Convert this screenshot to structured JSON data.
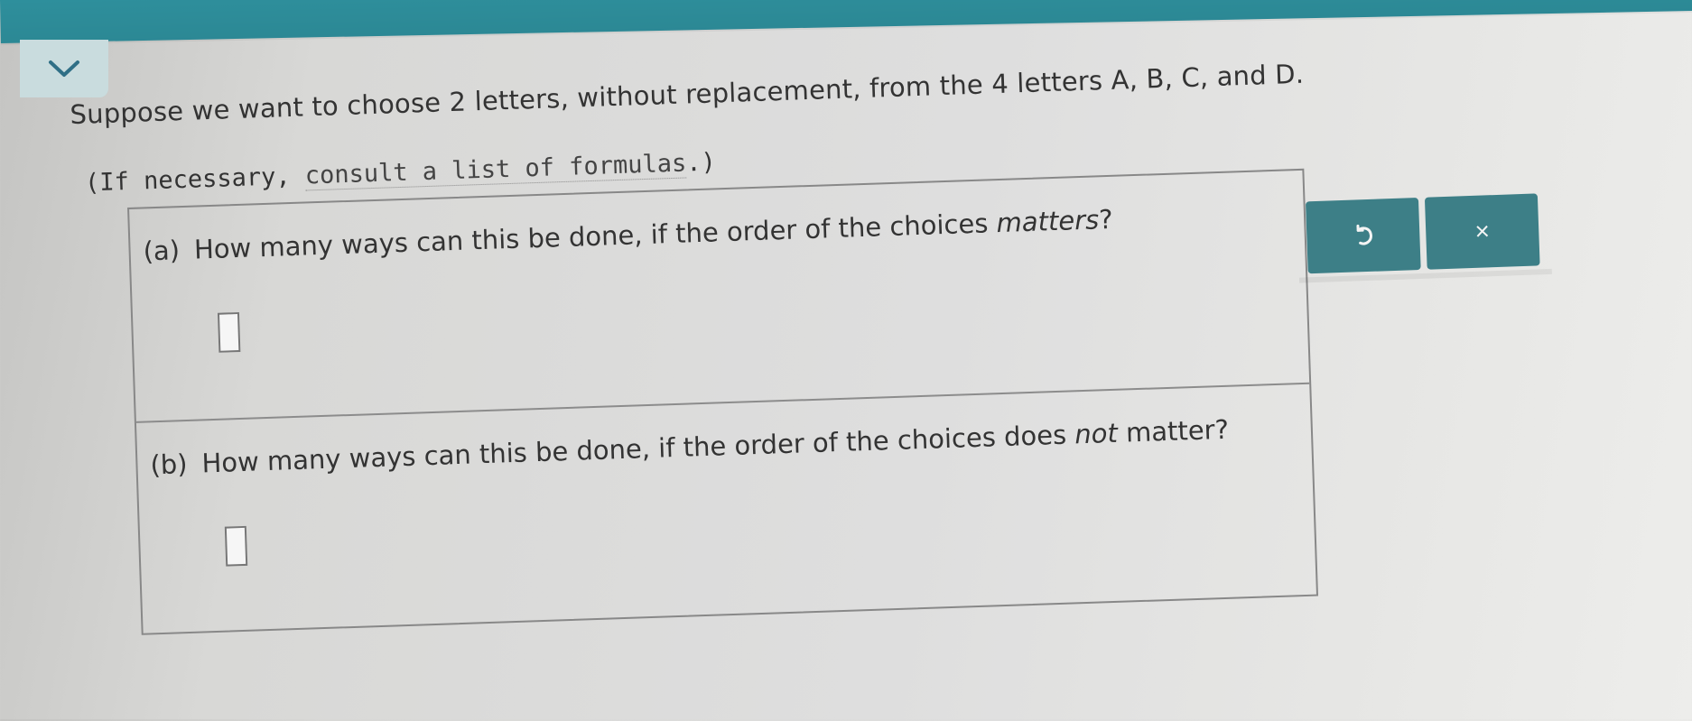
{
  "header": {
    "collapse_icon": "chevron-down-icon"
  },
  "problem": {
    "intro": "Suppose we want to choose 2 letters, without replacement, from the 4 letters A, B, C, and D.",
    "formulas_prefix": "(If necessary, ",
    "formulas_link": "consult a list of formulas",
    "formulas_suffix": ".)"
  },
  "parts": [
    {
      "label": "(a)",
      "question_start": "How many ways can this be done, if the order of the choices ",
      "question_em": "matters",
      "question_end": "?",
      "answer": ""
    },
    {
      "label": "(b)",
      "question_start": "How many ways can this be done, if the order of the choices does ",
      "question_em": "not",
      "question_end": " matter?",
      "answer": ""
    }
  ],
  "toolbar": {
    "undo_icon": "undo-icon",
    "clear_icon": "close-icon",
    "clear_label": "×"
  },
  "colors": {
    "header_bar": "#2e8f9c",
    "button": "#3d7f87"
  }
}
